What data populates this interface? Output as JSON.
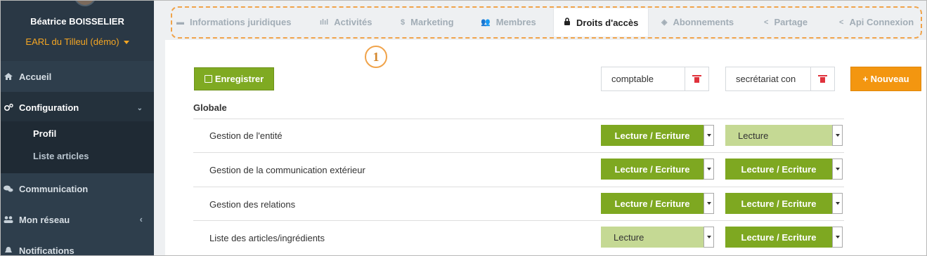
{
  "sidebar": {
    "user_name": "Béatrice BOISSELIER",
    "organization": "EARL du Tilleul (démo)",
    "items": [
      {
        "label": "Accueil",
        "icon": "home-icon"
      },
      {
        "label": "Configuration",
        "icon": "cogs-icon",
        "chevron": "⌄"
      },
      {
        "label": "Communication",
        "icon": "comments-icon"
      },
      {
        "label": "Mon réseau",
        "icon": "users-icon",
        "chevron": "‹"
      },
      {
        "label": "Notifications",
        "icon": "bell-icon"
      }
    ],
    "sub_items": [
      "Profil",
      "Liste articles"
    ]
  },
  "tabs": [
    {
      "label": "Informations juridiques",
      "icon": "folder-icon",
      "glyph": "▬"
    },
    {
      "label": "Activités",
      "icon": "bar-chart-icon",
      "glyph": "ılıl"
    },
    {
      "label": "Marketing",
      "icon": "dollar-icon",
      "glyph": "$"
    },
    {
      "label": "Membres",
      "icon": "users-icon",
      "glyph": "👥"
    },
    {
      "label": "Droits d'accès",
      "icon": "lock-icon",
      "glyph": "🔒"
    },
    {
      "label": "Abonnements",
      "icon": "tag-icon",
      "glyph": "◈"
    },
    {
      "label": "Partage",
      "icon": "share-icon",
      "glyph": "<"
    },
    {
      "label": "Api Connexion",
      "icon": "share-icon",
      "glyph": "<"
    }
  ],
  "annotation_number": "1",
  "toolbar": {
    "save_label": "Enregistrer",
    "roles": [
      "comptable",
      "secrétariat con"
    ],
    "new_label": "+ Nouveau"
  },
  "section": "Globale",
  "rows": [
    {
      "label": "Gestion de l'entité",
      "values": [
        "Lecture / Ecriture",
        "Lecture"
      ]
    },
    {
      "label": "Gestion de la communication extérieur",
      "values": [
        "Lecture / Ecriture",
        "Lecture / Ecriture"
      ]
    },
    {
      "label": "Gestion des relations",
      "values": [
        "Lecture / Ecriture",
        "Lecture / Ecriture"
      ]
    },
    {
      "label": "Liste des articles/ingrédients",
      "values": [
        "Lecture",
        "Lecture / Ecriture"
      ]
    }
  ],
  "colors": {
    "sidebar_bg": "#2e3e4c",
    "accent_orange": "#f39610",
    "green_rw": "#7ea821",
    "green_r": "#c5d994",
    "annotation": "#f0a34a"
  }
}
